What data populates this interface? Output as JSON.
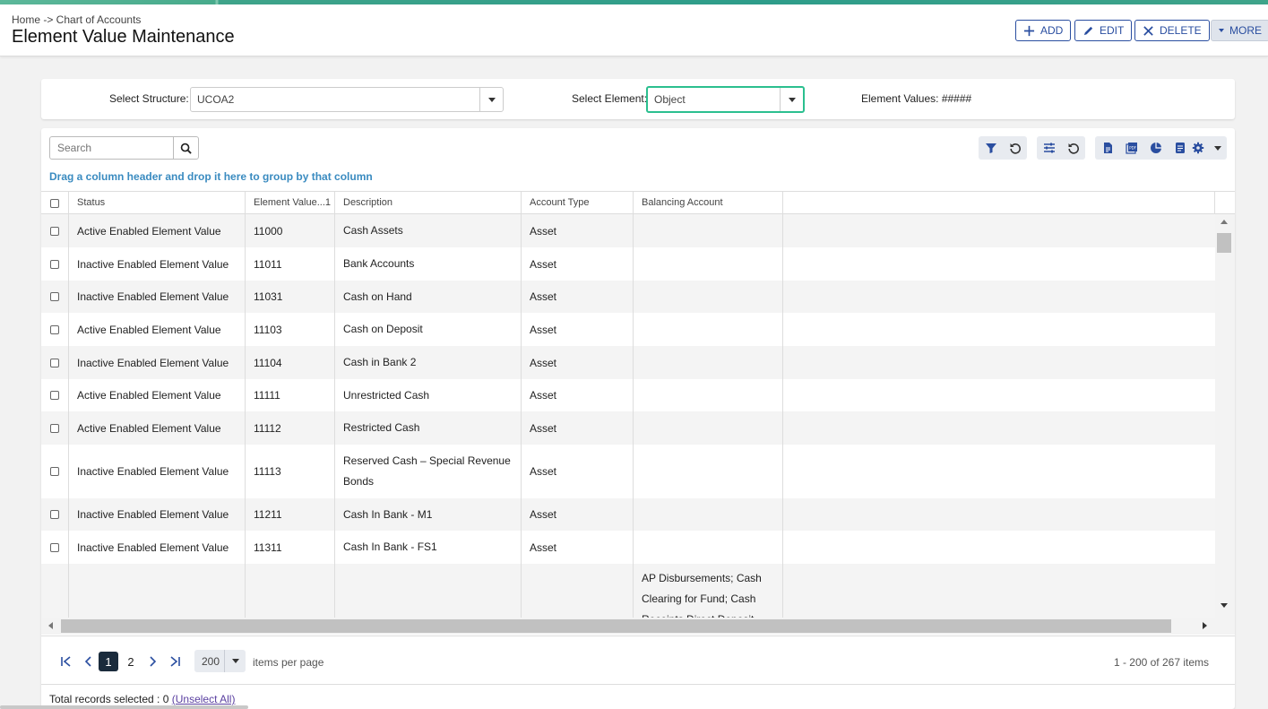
{
  "header": {
    "breadcrumb": "Home -> Chart of Accounts",
    "title": "Element Value Maintenance",
    "buttons": {
      "add": "ADD",
      "edit": "EDIT",
      "delete": "DELETE",
      "more": "MORE"
    }
  },
  "filters": {
    "structure_label": "Select Structure:",
    "structure_value": "UCOA2",
    "element_label": "Select Element:",
    "element_value": "Object",
    "element_values_label": "Element Values: #####"
  },
  "grid": {
    "search_placeholder": "Search",
    "group_hint": "Drag a column header and drop it here to group by that column",
    "columns": [
      "Status",
      "Element Value...1",
      "Description",
      "Account Type",
      "Balancing Account"
    ],
    "rows": [
      {
        "status": "Active Enabled Element Value",
        "value": "11000",
        "description": "Cash Assets",
        "type": "Asset",
        "balancing": ""
      },
      {
        "status": "Inactive Enabled Element Value",
        "value": "11011",
        "description": "Bank Accounts",
        "type": "Asset",
        "balancing": ""
      },
      {
        "status": "Inactive Enabled Element Value",
        "value": "11031",
        "description": "Cash on Hand",
        "type": "Asset",
        "balancing": ""
      },
      {
        "status": "Active Enabled Element Value",
        "value": "11103",
        "description": "Cash on Deposit",
        "type": "Asset",
        "balancing": ""
      },
      {
        "status": "Inactive Enabled Element Value",
        "value": "11104",
        "description": "Cash in Bank 2",
        "type": "Asset",
        "balancing": ""
      },
      {
        "status": "Active Enabled Element Value",
        "value": "11111",
        "description": "Unrestricted Cash",
        "type": "Asset",
        "balancing": ""
      },
      {
        "status": "Active Enabled Element Value",
        "value": "11112",
        "description": "Restricted Cash",
        "type": "Asset",
        "balancing": ""
      },
      {
        "status": "Inactive Enabled Element Value",
        "value": "11113",
        "description": "Reserved Cash – Special Revenue Bonds",
        "type": "Asset",
        "balancing": ""
      },
      {
        "status": "Inactive Enabled Element Value",
        "value": "11211",
        "description": "Cash In Bank - M1",
        "type": "Asset",
        "balancing": ""
      },
      {
        "status": "Inactive Enabled Element Value",
        "value": "11311",
        "description": "Cash In Bank - FS1",
        "type": "Asset",
        "balancing": ""
      },
      {
        "status": "",
        "value": "",
        "description": "",
        "type": "",
        "balancing": "AP Disbursements; Cash Clearing for Fund; Cash Receipts Direct Deposit"
      }
    ]
  },
  "pager": {
    "pages": [
      "1",
      "2"
    ],
    "active_page": "1",
    "page_size": "200",
    "items_per_page_label": "items per page",
    "info": "1 - 200 of 267 items"
  },
  "footer": {
    "selected_text": "Total records selected : 0",
    "unselect_link": "(Unselect All)"
  },
  "colors": {
    "accent": "#2a4ea0",
    "focus": "#2bbf8f",
    "hint": "#3a8bc0"
  }
}
